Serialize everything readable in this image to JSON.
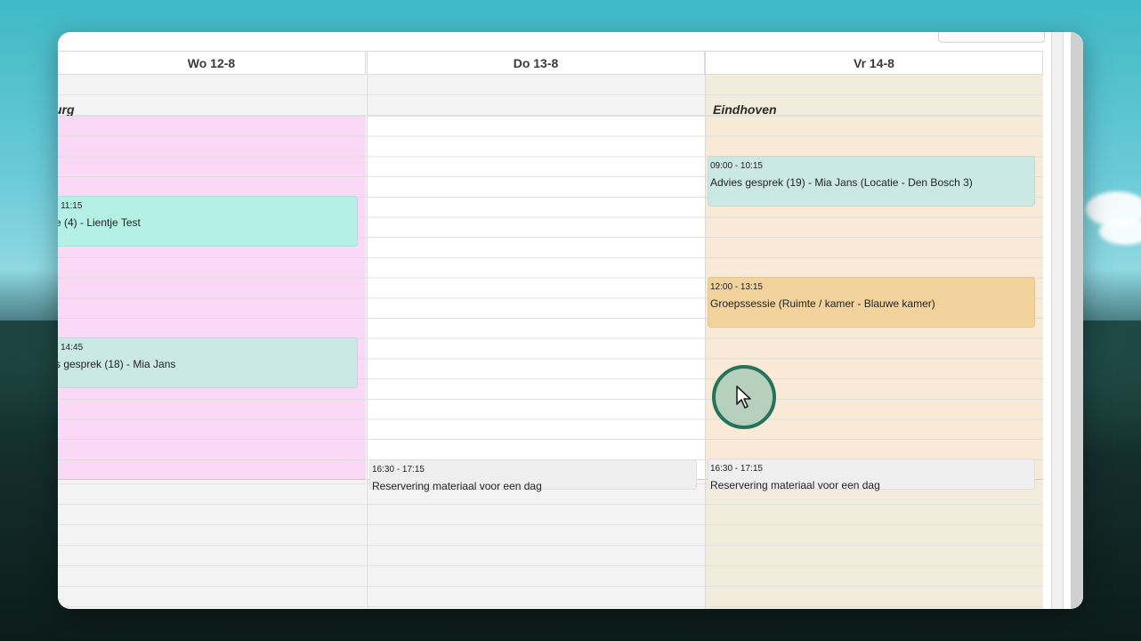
{
  "calendar": {
    "days": [
      {
        "label": "Wo 12-8",
        "location": "urg"
      },
      {
        "label": "Do 13-8",
        "location": ""
      },
      {
        "label": "Vr 14-8",
        "location": "Eindhoven"
      }
    ],
    "events": {
      "wo_1": {
        "time": "- 11:15",
        "title": "e (4) - Lientje Test"
      },
      "wo_2": {
        "time": "- 14:45",
        "title": "s gesprek (18) - Mia Jans"
      },
      "do_1": {
        "time": "16:30 - 17:15",
        "title": "Reservering materiaal voor een dag"
      },
      "vr_1": {
        "time": "09:00 - 10:15",
        "title": "Advies gesprek (19) - Mia Jans (Locatie - Den Bosch 3)"
      },
      "vr_2": {
        "time": "12:00 - 13:15",
        "title": "Groepssessie (Ruimte / kamer - Blauwe kamer)"
      },
      "vr_3": {
        "time": "16:30 - 17:15",
        "title": "Reservering materiaal voor een dag"
      }
    },
    "colors": {
      "wo_avail": "#f9d9f5",
      "vr_avail": "#f8ead6",
      "teal_event": "#b5f0e6",
      "mint_event": "#cbe9e4",
      "orange_event": "#f2d39c",
      "grey_event": "#efefef",
      "cursor_ring": "#25735a"
    }
  }
}
